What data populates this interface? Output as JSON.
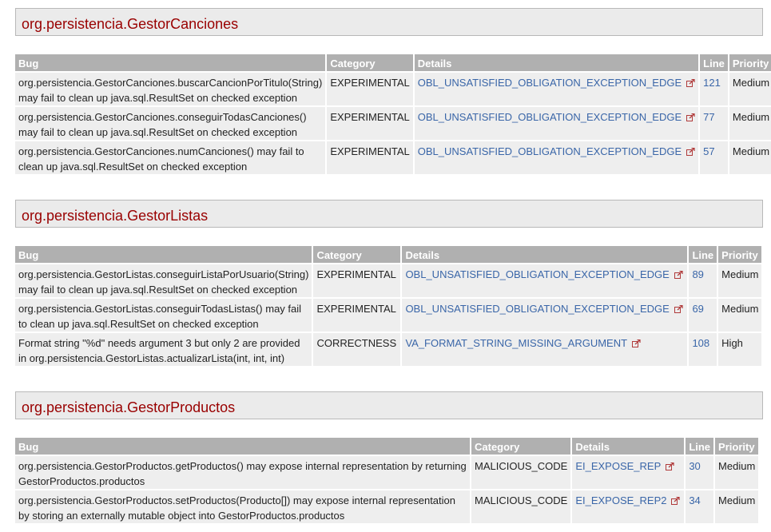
{
  "columns": {
    "bug": "Bug",
    "category": "Category",
    "details": "Details",
    "line": "Line",
    "priority": "Priority"
  },
  "sections": [
    {
      "title": "org.persistencia.GestorCanciones",
      "rows": [
        {
          "bug": "org.persistencia.GestorCanciones.buscarCancionPorTitulo(String) may fail to clean up java.sql.ResultSet on checked exception",
          "category": "EXPERIMENTAL",
          "details": "OBL_UNSATISFIED_OBLIGATION_EXCEPTION_EDGE",
          "line": "121",
          "priority": "Medium"
        },
        {
          "bug": "org.persistencia.GestorCanciones.conseguirTodasCanciones() may fail to clean up java.sql.ResultSet on checked exception",
          "category": "EXPERIMENTAL",
          "details": "OBL_UNSATISFIED_OBLIGATION_EXCEPTION_EDGE",
          "line": "77",
          "priority": "Medium"
        },
        {
          "bug": "org.persistencia.GestorCanciones.numCanciones() may fail to clean up java.sql.ResultSet on checked exception",
          "category": "EXPERIMENTAL",
          "details": "OBL_UNSATISFIED_OBLIGATION_EXCEPTION_EDGE",
          "line": "57",
          "priority": "Medium"
        }
      ]
    },
    {
      "title": "org.persistencia.GestorListas",
      "rows": [
        {
          "bug": "org.persistencia.GestorListas.conseguirListaPorUsuario(String) may fail to clean up java.sql.ResultSet on checked exception",
          "category": "EXPERIMENTAL",
          "details": "OBL_UNSATISFIED_OBLIGATION_EXCEPTION_EDGE",
          "line": "89",
          "priority": "Medium"
        },
        {
          "bug": "org.persistencia.GestorListas.conseguirTodasListas() may fail to clean up java.sql.ResultSet on checked exception",
          "category": "EXPERIMENTAL",
          "details": "OBL_UNSATISFIED_OBLIGATION_EXCEPTION_EDGE",
          "line": "69",
          "priority": "Medium"
        },
        {
          "bug": "Format string \"%d\" needs argument 3 but only 2 are provided in org.persistencia.GestorListas.actualizarLista(int, int, int)",
          "category": "CORRECTNESS",
          "details": "VA_FORMAT_STRING_MISSING_ARGUMENT",
          "line": "108",
          "priority": "High"
        }
      ]
    },
    {
      "title": "org.persistencia.GestorProductos",
      "rows": [
        {
          "bug": "org.persistencia.GestorProductos.getProductos() may expose internal representation by returning GestorProductos.productos",
          "category": "MALICIOUS_CODE",
          "details": "EI_EXPOSE_REP",
          "line": "30",
          "priority": "Medium"
        },
        {
          "bug": "org.persistencia.GestorProductos.setProductos(Producto[]) may expose internal representation by storing an externally mutable object into GestorProductos.productos",
          "category": "MALICIOUS_CODE",
          "details": "EI_EXPOSE_REP2",
          "line": "34",
          "priority": "Medium"
        }
      ]
    }
  ]
}
